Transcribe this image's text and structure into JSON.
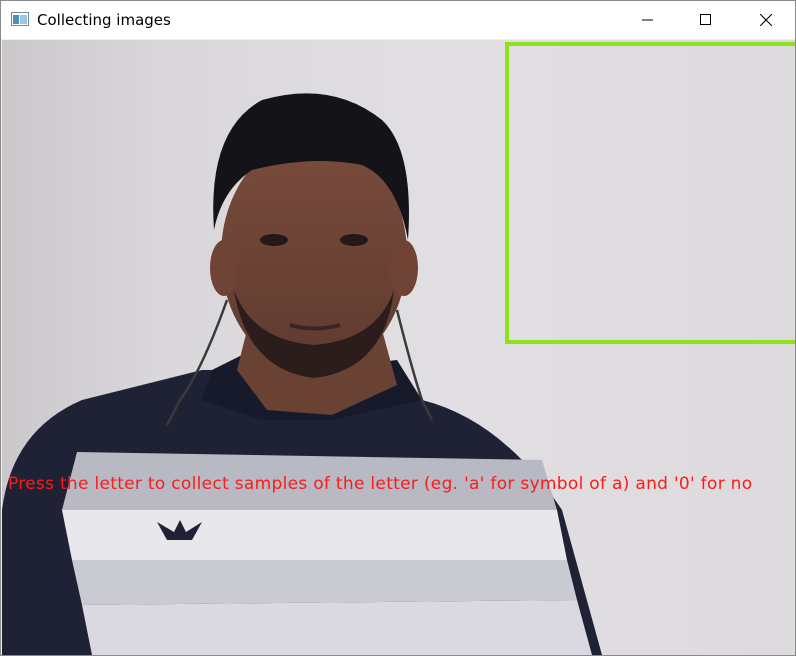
{
  "window": {
    "title": "Collecting images",
    "controls": {
      "minimize": "minimize-icon",
      "maximize": "maximize-icon",
      "close": "close-icon"
    }
  },
  "camera": {
    "instruction": "Press the letter to collect samples of the letter (eg. 'a' for symbol of a) and '0' for no",
    "box_color": "#8fe01e",
    "text_color": "#ff1a1a"
  }
}
